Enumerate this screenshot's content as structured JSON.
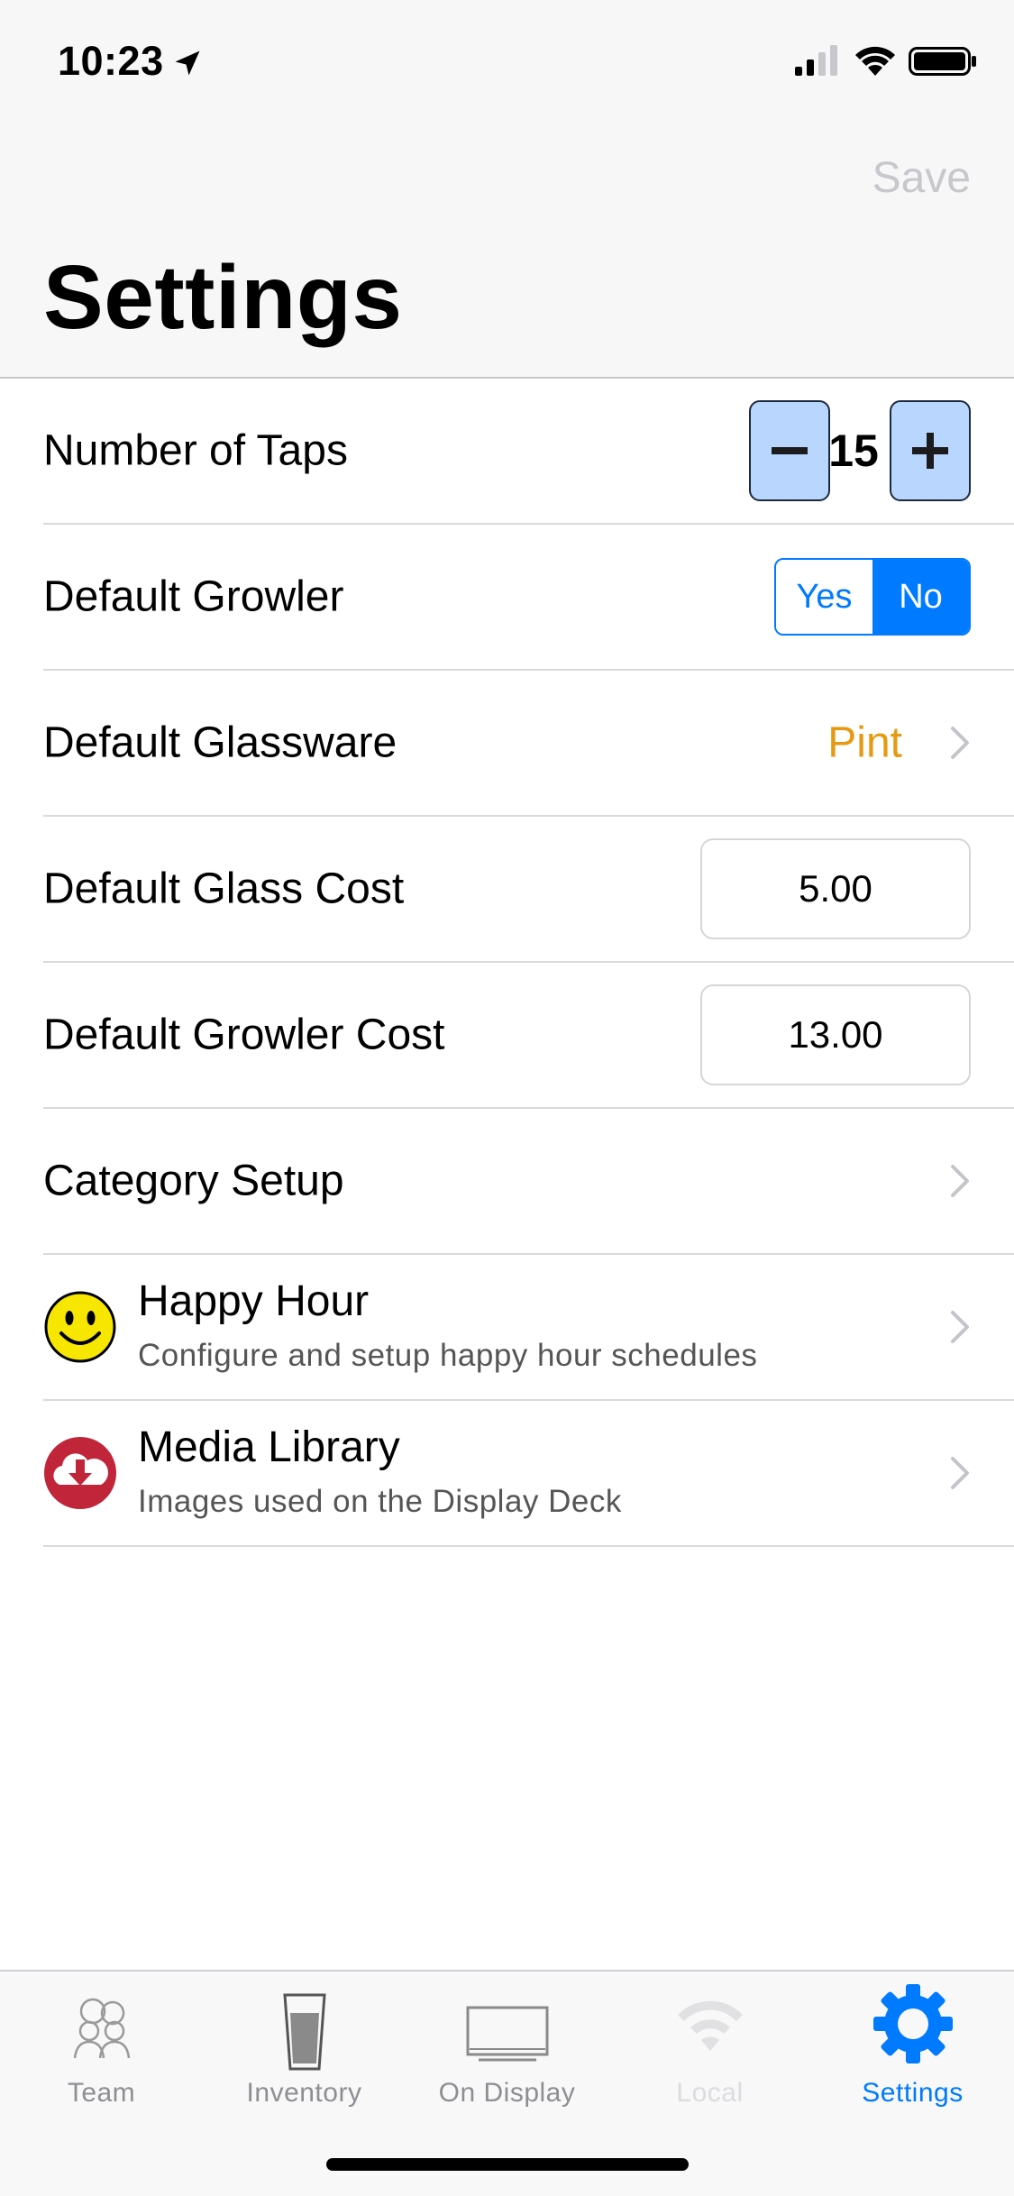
{
  "status_bar": {
    "time": "10:23"
  },
  "nav": {
    "save_label": "Save",
    "title": "Settings"
  },
  "settings": {
    "taps": {
      "label": "Number of Taps",
      "value": "15"
    },
    "growler": {
      "label": "Default Growler",
      "options": [
        "Yes",
        "No"
      ],
      "selected": "No"
    },
    "glassware": {
      "label": "Default Glassware",
      "value": "Pint"
    },
    "glass_cost": {
      "label": "Default Glass Cost",
      "value": "5.00"
    },
    "growler_cost": {
      "label": "Default Growler Cost",
      "value": "13.00"
    },
    "category": {
      "label": "Category Setup"
    },
    "happy_hour": {
      "label": "Happy Hour",
      "subtitle": "Configure and setup happy hour schedules",
      "icon": "smiley-icon"
    },
    "media_library": {
      "label": "Media Library",
      "subtitle": "Images used on the Display Deck",
      "icon": "cloud-download-icon"
    }
  },
  "tabs": [
    {
      "label": "Team",
      "icon": "team-icon",
      "state": "normal"
    },
    {
      "label": "Inventory",
      "icon": "pint-glass-icon",
      "state": "normal"
    },
    {
      "label": "On Display",
      "icon": "monitor-icon",
      "state": "normal"
    },
    {
      "label": "Local",
      "icon": "wifi-icon",
      "state": "disabled"
    },
    {
      "label": "Settings",
      "icon": "gear-icon",
      "state": "active"
    }
  ],
  "colors": {
    "accent": "#007aff",
    "value_orange": "#e69a12",
    "stepper_fill": "#b9d6ff",
    "media_red": "#c1253a",
    "smiley_yellow": "#f7e600"
  }
}
